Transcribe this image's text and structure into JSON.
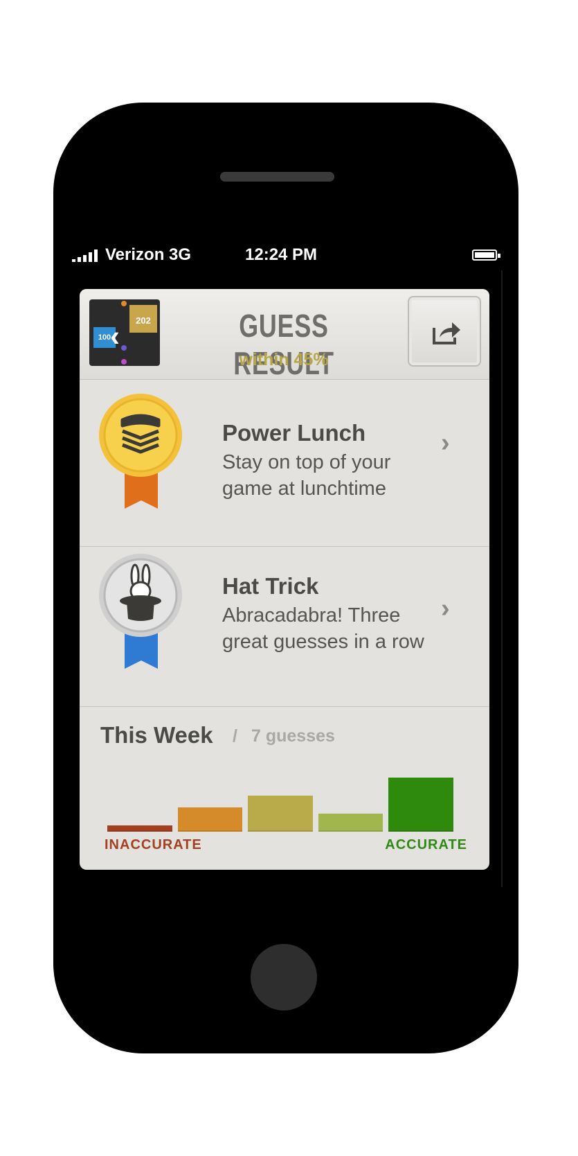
{
  "status_bar": {
    "carrier": "Verizon  3G",
    "time": "12:24 PM"
  },
  "header": {
    "title": "GUESS RESULT",
    "subtitle": "within 45%",
    "thumbnail": {
      "left_value": "100",
      "right_value": "202"
    },
    "share_icon": "share-arrow-icon"
  },
  "achievements": [
    {
      "title": "Power Lunch",
      "description": "Stay on top of your game at lunchtime",
      "badge": "gold-sandwich-badge-icon",
      "ribbon_color": "#e06f1b"
    },
    {
      "title": "Hat Trick",
      "description": "Abracadabra! Three great guesses in a row",
      "badge": "silver-magic-hat-badge-icon",
      "ribbon_color": "#2f7ad3"
    }
  ],
  "week": {
    "title": "This Week",
    "separator": "/",
    "count": "7 guesses",
    "label_left": "INACCURATE",
    "label_right": "ACCURATE"
  },
  "chart_data": {
    "type": "bar",
    "categories": [
      "1",
      "2",
      "3",
      "4",
      "5"
    ],
    "values": [
      0.5,
      2,
      3,
      1.5,
      4.5
    ],
    "colors": [
      "#a4401f",
      "#d68b2a",
      "#b9aa4a",
      "#a2b64e",
      "#2e8a0c"
    ],
    "ylim": [
      0,
      4.5
    ]
  }
}
